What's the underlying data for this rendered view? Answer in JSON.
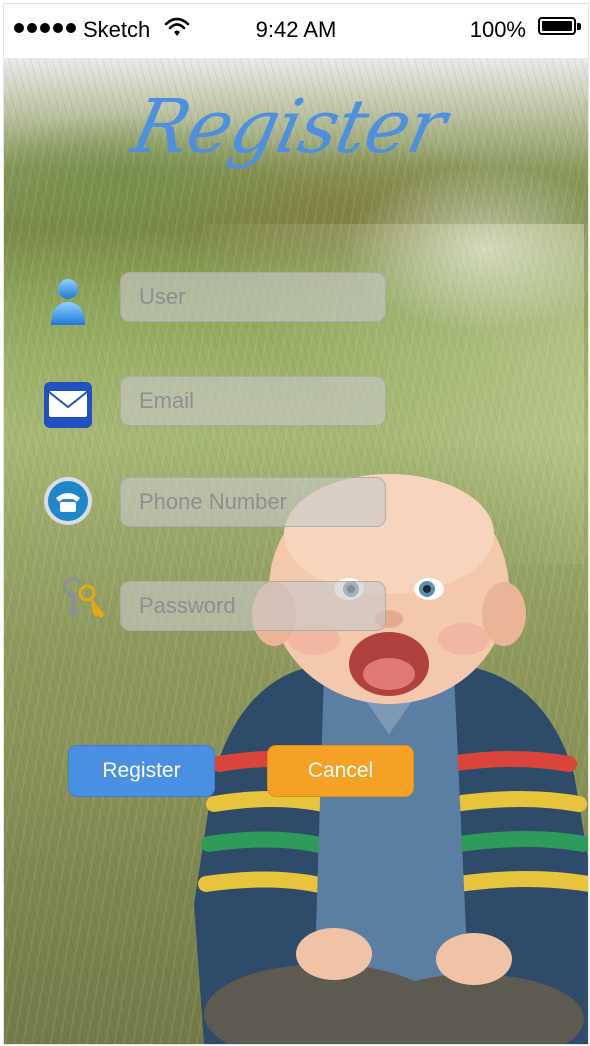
{
  "status_bar": {
    "carrier": "Sketch",
    "time": "9:42 AM",
    "battery": "100%"
  },
  "title": "Register",
  "form": {
    "user": {
      "placeholder": "User",
      "icon": "user-icon"
    },
    "email": {
      "placeholder": "Email",
      "icon": "mail-icon"
    },
    "phone": {
      "placeholder": "Phone Number",
      "icon": "phone-icon"
    },
    "password": {
      "placeholder": "Password",
      "icon": "keys-icon"
    }
  },
  "buttons": {
    "register": "Register",
    "cancel": "Cancel"
  },
  "colors": {
    "title": "#4f8fe0",
    "register_button": "#4a90e2",
    "cancel_button": "#f4a126"
  }
}
